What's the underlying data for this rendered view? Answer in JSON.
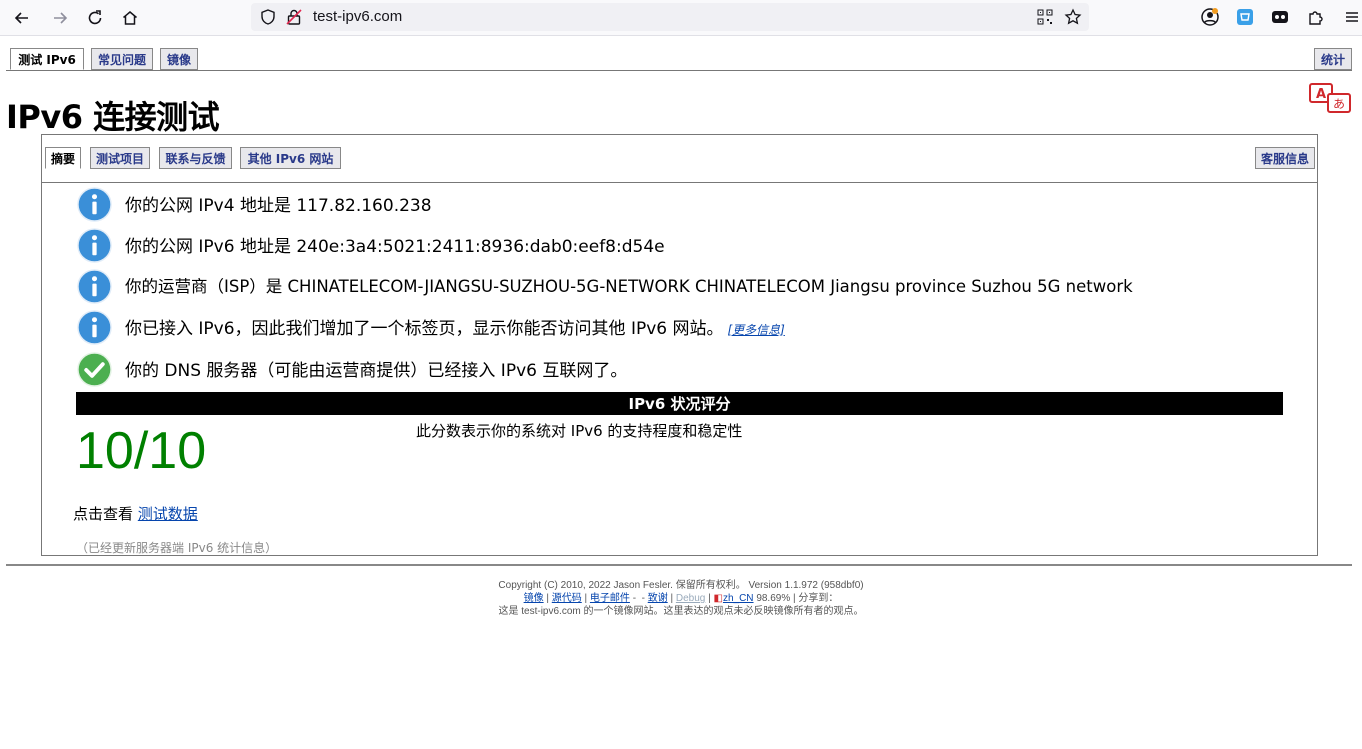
{
  "browser": {
    "url": "test-ipv6.com"
  },
  "top_tabs": [
    "测试 IPv6",
    "常见问题",
    "镜像"
  ],
  "top_tab_right": "统计",
  "page_title": "IPv6 连接测试",
  "sub_tabs": [
    "摘要",
    "测试项目",
    "联系与反馈",
    "其他 IPv6 网站"
  ],
  "sub_tab_right": "客服信息",
  "info_rows": [
    {
      "icon": "info-icon",
      "text": "你的公网 IPv4 地址是 117.82.160.238"
    },
    {
      "icon": "info-icon",
      "text": "你的公网 IPv6 地址是 240e:3a4:5021:2411:8936:dab0:eef8:d54e"
    },
    {
      "icon": "info-icon",
      "text": "你的运营商（ISP）是 CHINATELECOM-JIANGSU-SUZHOU-5G-NETWORK CHINATELECOM Jiangsu province Suzhou 5G network"
    },
    {
      "icon": "info-icon",
      "text": "你已接入 IPv6，因此我们增加了一个标签页，显示你能否访问其他 IPv6 网站。",
      "link": "[更多信息]"
    },
    {
      "icon": "check-icon",
      "text": "你的 DNS 服务器（可能由运营商提供）已经接入 IPv6 互联网了。"
    }
  ],
  "score_section": {
    "header": "IPv6 状况评分",
    "score": "10/10",
    "description": "此分数表示你的系统对 IPv6 的支持程度和稳定性"
  },
  "click_view": {
    "prefix": "点击查看",
    "link": "测试数据"
  },
  "updated_note": "（已经更新服务器端 IPv6 统计信息）",
  "footer": {
    "copyright": "Copyright (C) 2010, 2022 Jason Fesler. 保留所有权利。 Version 1.1.972 (958dbf0)",
    "links": {
      "mirror": "镜像",
      "source": "源代码",
      "email": "电子邮件",
      "dash": "-",
      "thanks": "致谢",
      "debug": "Debug",
      "locale": "zh_CN",
      "percent": "98.69%",
      "share": "分享到："
    },
    "mirror_note": "这是 test-ipv6.com 的一个镜像网站。这里表达的观点未必反映镜像所有者的观点。"
  },
  "colors": {
    "score_green": "#008000",
    "info_blue": "#3a8fd8",
    "check_green": "#4caf50",
    "link_blue": "#0645ad"
  }
}
